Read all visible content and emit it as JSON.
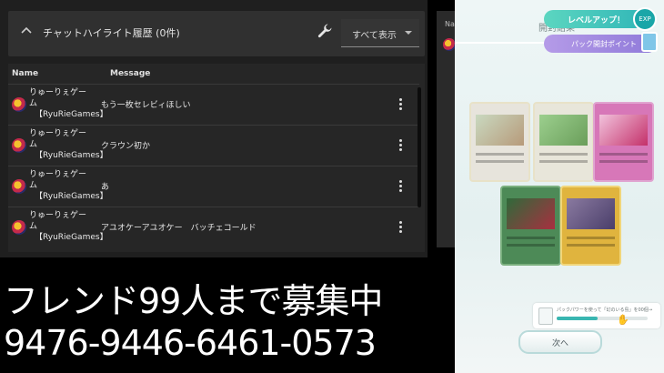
{
  "chat": {
    "header_title": "チャットハイライト履歴 (0件)",
    "filter_value": "すべて表示",
    "columns": {
      "name": "Name",
      "message": "Message"
    },
    "rows": [
      {
        "name_line1": "りゅーりぇゲー",
        "name_line2": "ム",
        "tag": "【RyuRieGames】",
        "message": "もう一枚セレビィほしい"
      },
      {
        "name_line1": "りゅーりぇゲー",
        "name_line2": "ム",
        "tag": "【RyuRieGames】",
        "message": "クラウン初か"
      },
      {
        "name_line1": "りゅーりぇゲー",
        "name_line2": "ム",
        "tag": "【RyuRieGames】",
        "message": "あ"
      },
      {
        "name_line1": "りゅーりぇゲー",
        "name_line2": "ム",
        "tag": "【RyuRieGames】",
        "message": "アユオケーアユオケー　バッチェコールド"
      }
    ],
    "side_panel_label": "Na"
  },
  "overlay": {
    "line1": "フレンド99人まで募集中",
    "line2": "9476-9446-6461-0573"
  },
  "game": {
    "title": "開封結果",
    "level_up": "レベルアップ！",
    "exp_badge": "EXP",
    "pack_points": "パック開封ポイント",
    "progress_text": "パックパワーを使って「幻のいる島」を00個→",
    "progress_fraction": 0.45,
    "next_button": "次へ"
  },
  "colors": {
    "panel_bg": "#1f1f1f",
    "header_bg": "#303030",
    "accent_teal": "#2fb5b7",
    "accent_purple": "#8f7ad9"
  }
}
